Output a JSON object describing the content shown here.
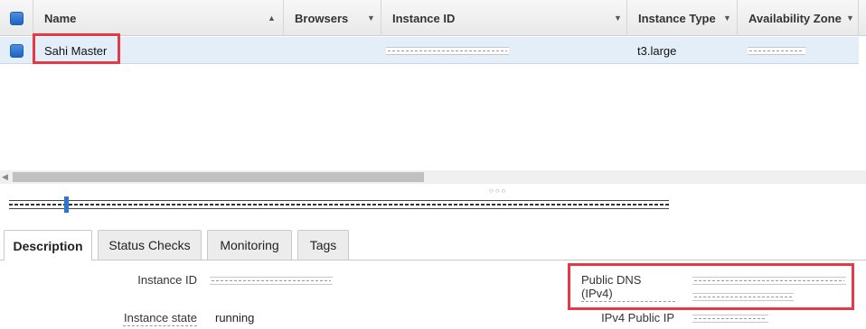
{
  "table": {
    "columns": [
      {
        "label": "Name",
        "sort": "▲"
      },
      {
        "label": "Browsers",
        "sort": "▼"
      },
      {
        "label": "Instance ID",
        "sort": "▼"
      },
      {
        "label": "Instance Type",
        "sort": "▼"
      },
      {
        "label": "Availability Zone",
        "sort": "▼"
      }
    ],
    "rows": [
      {
        "name": "Sahi Master",
        "instance_type": "t3.large"
      }
    ]
  },
  "tabs": [
    "Description",
    "Status Checks",
    "Monitoring",
    "Tags"
  ],
  "details": {
    "instance_id_label": "Instance ID",
    "instance_state_label": "Instance state",
    "instance_state_value": "running",
    "public_dns_label": "Public DNS (IPv4)",
    "ipv4_label": "IPv4 Public IP"
  },
  "colors": {
    "highlight_box": "#e53945",
    "selected_row": "#e4eef9",
    "checkbox": "#1e63c3"
  }
}
